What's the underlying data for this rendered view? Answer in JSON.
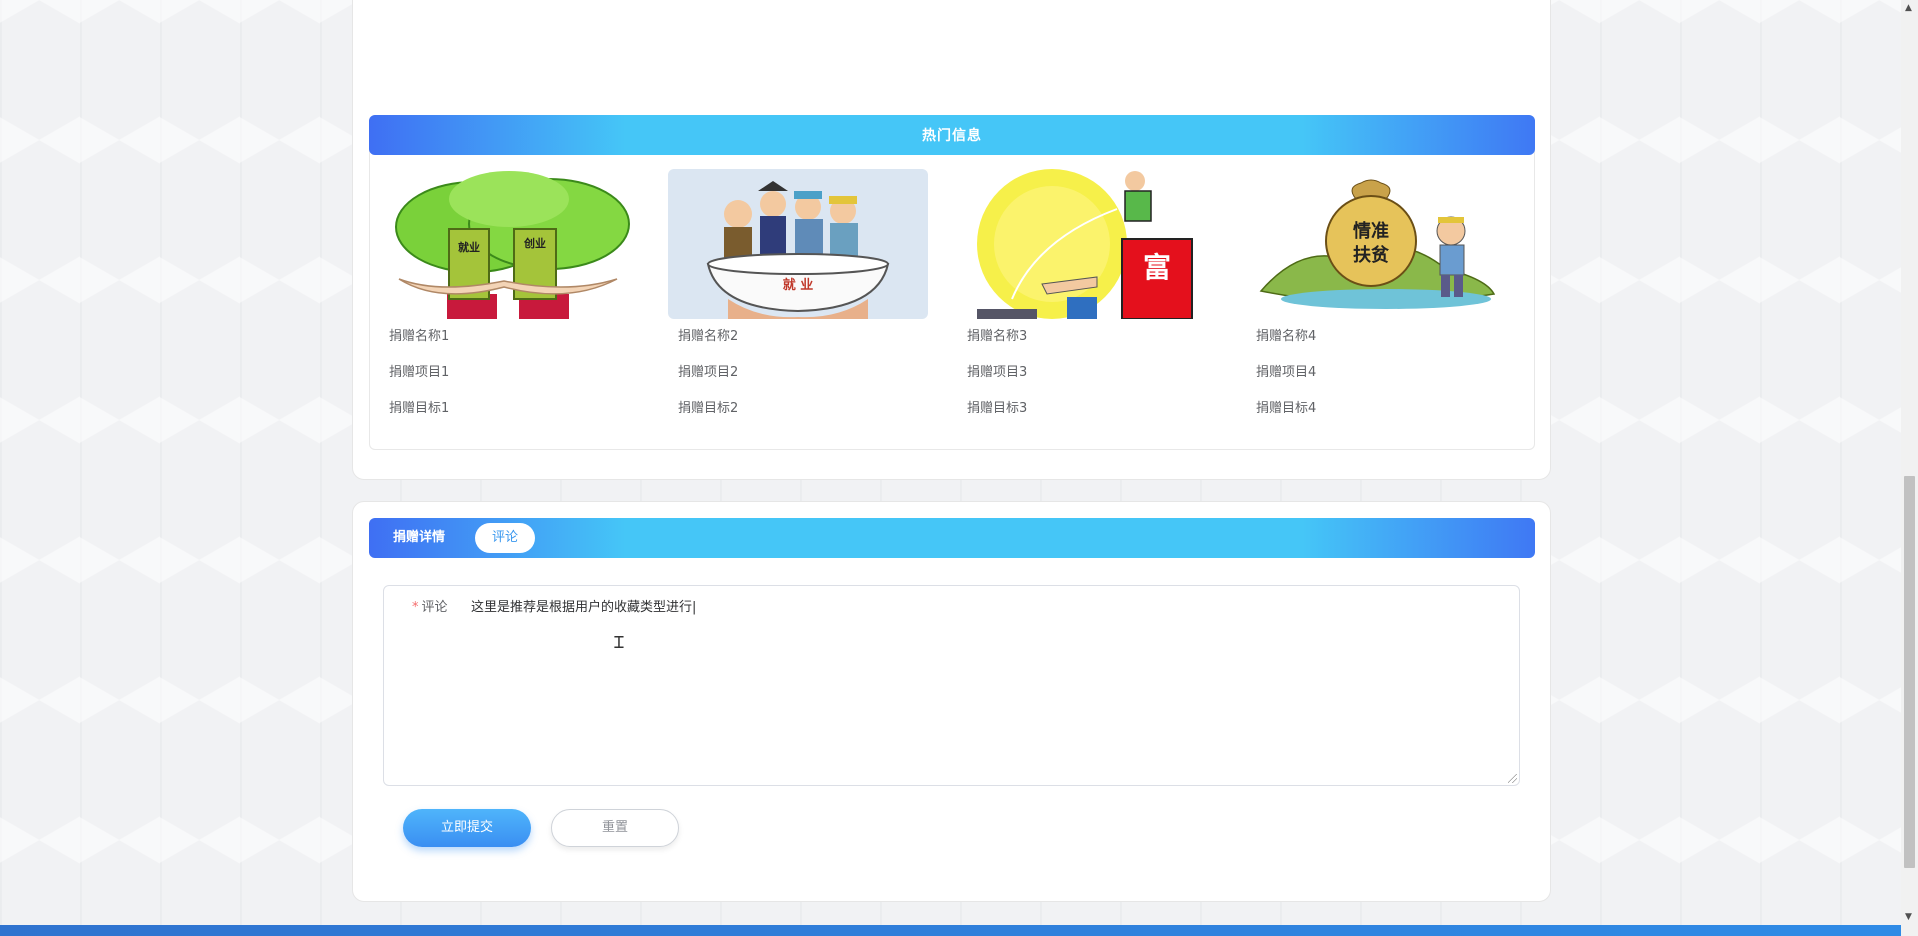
{
  "hot_section": {
    "title": "热门信息"
  },
  "hot_items": [
    {
      "name": "捐赠名称1",
      "project": "捐赠项目1",
      "goal": "捐赠目标1",
      "image": "trees-employment-illustration"
    },
    {
      "name": "捐赠名称2",
      "project": "捐赠项目2",
      "goal": "捐赠目标2",
      "image": "employment-bowl-illustration"
    },
    {
      "name": "捐赠名称3",
      "project": "捐赠项目3",
      "goal": "捐赠目标3",
      "image": "rich-jump-illustration"
    },
    {
      "name": "捐赠名称4",
      "project": "捐赠项目4",
      "goal": "捐赠目标4",
      "image": "poverty-alleviation-illustration"
    }
  ],
  "illustration_text": {
    "tree_left": "就业",
    "tree_right": "创业",
    "bowl": "就 业",
    "rich": "富",
    "bag_top": "情准",
    "bag_bottom": "扶贫"
  },
  "tabs": {
    "detail": "捐赠详情",
    "comment": "评论"
  },
  "comment_form": {
    "required_mark": "*",
    "label": "评论",
    "value": "这里是推荐是根据用户的收藏类型进行|",
    "submit_label": "立即提交",
    "reset_label": "重置"
  },
  "icons": {
    "text_cursor": "Ꮖ",
    "scroll_up": "▲",
    "scroll_down": "▼"
  },
  "colors": {
    "accent_blue": "#3a8ef2",
    "banner_light": "#45c6f7",
    "banner_dark": "#3f6ff3",
    "required": "#f56c6c"
  }
}
